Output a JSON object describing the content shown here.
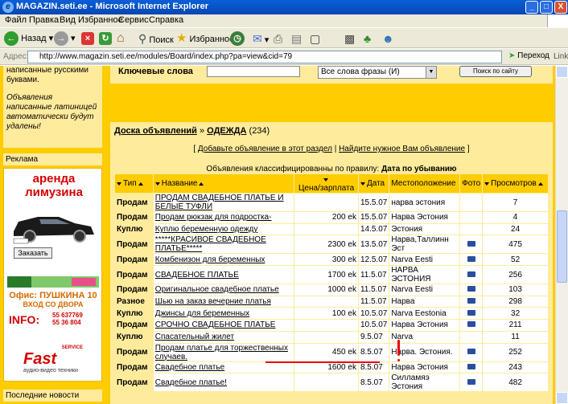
{
  "window": {
    "title": "MAGAZIN.seti.ee - Microsoft Internet Explorer",
    "minimize": "_",
    "maximize": "□",
    "close": "X"
  },
  "menu": [
    "Файл",
    "Правка",
    "Вид",
    "Избранное",
    "Сервис",
    "Справка"
  ],
  "toolbar": {
    "back": "Назад",
    "search": "Поиск",
    "favorites": "Избранное"
  },
  "address": {
    "label": "Адрес:",
    "url": "http://www.magazin.seti.ee/modules/Board/index.php?pa=view&cid=79",
    "go": "Переход",
    "links": "Links"
  },
  "sidebar": {
    "note1": "написанные русскими буквами.",
    "note2": "Объявления написанные латиницей автоматически будут удалены!",
    "ads_title": "Реклама",
    "limo_line1": "аренда",
    "limo_line2": "лимузина",
    "limo_order": "Заказать",
    "office": "Офис: ПУШКИНА 10",
    "office_enter": "ВХОД СО ДВОРА",
    "info": "INFO:",
    "phone1": "55 637769",
    "phone2": "55 36 804",
    "fast": "Fast",
    "fast_service": "SERVICE",
    "fast_sub": "аудио-видео техники",
    "news_title": "Последние новости"
  },
  "search": {
    "keywords_label": "Ключевые слова",
    "mode_selected": "Все слова фразы (И)",
    "button": "Поиск по сайту"
  },
  "board": {
    "crumb_root": "Доска объявлений",
    "crumb_sep": "»",
    "category": "ОДЕЖДА",
    "count": "(234)",
    "add_link": "Добавьте объявление в этот раздел",
    "find_link": "Найдите нужное Вам объявление",
    "sort_prefix": "Объявления классифицированны по правилу:",
    "sort_rule": "Дата по убыванию"
  },
  "table": {
    "headers": {
      "type": "Тип",
      "title": "Название",
      "price": "Цена/зарплата",
      "date": "Дата",
      "location": "Местоположение",
      "photo": "Фото",
      "views": "Просмотров"
    },
    "rows": [
      {
        "type": "Продам",
        "title": "ПРОДАМ СВАДЕБНОЕ ПЛАТЬЕ И БЕЛЫЕ ТУФЛИ",
        "price": "",
        "date": "15.5.07",
        "location": "нарва эстония",
        "photo": false,
        "views": "7"
      },
      {
        "type": "Продам",
        "title": "Продам рюкзак для подростка-",
        "price": "200 ek",
        "date": "15.5.07",
        "location": "Нарва Эстония",
        "photo": false,
        "views": "4"
      },
      {
        "type": "Куплю",
        "title": "Куплю беременную одежду",
        "price": "",
        "date": "14.5.07",
        "location": "Эстония",
        "photo": false,
        "views": "24"
      },
      {
        "type": "Продам",
        "title": "*****КРАСИВОЕ СВАДЕБНОЕ ПЛАТЬЕ*****",
        "price": "2300 ek",
        "date": "13.5.07",
        "location": "Нарва,Таллинн Эст",
        "photo": true,
        "views": "475"
      },
      {
        "type": "Продам",
        "title": "Комбенизон для беременных",
        "price": "300 ek",
        "date": "12.5.07",
        "location": "Narva Eesti",
        "photo": true,
        "views": "52"
      },
      {
        "type": "Продам",
        "title": "СВАДЕБНОЕ ПЛАТЬЕ",
        "price": "1700 ek",
        "date": "11.5.07",
        "location": "НАРВА ЭСТОНИЯ",
        "photo": true,
        "views": "256"
      },
      {
        "type": "Продам",
        "title": "Оригинальное свадебное платье",
        "price": "1000 ek",
        "date": "11.5.07",
        "location": "Narva Eesti",
        "photo": true,
        "views": "103"
      },
      {
        "type": "Разное",
        "title": "Шью на заказ вечерние платья",
        "price": "",
        "date": "11.5.07",
        "location": "Нарва",
        "photo": true,
        "views": "298"
      },
      {
        "type": "Куплю",
        "title": "Джинсы для беременных",
        "price": "100 ek",
        "date": "10.5.07",
        "location": "Narva Eestonia",
        "photo": true,
        "views": "32"
      },
      {
        "type": "Продам",
        "title": "СРОЧНО СВАДЕБНОЕ ПЛАТЬЕ",
        "price": "",
        "date": "10.5.07",
        "location": "Нарва Эстония",
        "photo": true,
        "views": "211"
      },
      {
        "type": "Куплю",
        "title": "Спасательный жилет",
        "price": "",
        "date": "9.5.07",
        "location": "Narva",
        "photo": false,
        "views": "11"
      },
      {
        "type": "Продам",
        "title": "Продам платье для торжественных случаев.",
        "price": "450 ek",
        "date": "8.5.07",
        "location": "Нарва. Эстония.",
        "photo": true,
        "views": "252"
      },
      {
        "type": "Продам",
        "title": "Свадебное платье",
        "price": "1600 ek",
        "date": "8.5.07",
        "location": "Нарва Эстония",
        "photo": true,
        "views": "243"
      },
      {
        "type": "Продам",
        "title": "Свадебное платье!",
        "price": "",
        "date": "8.5.07",
        "location": "Силламяэ Эстония",
        "photo": true,
        "views": "482"
      }
    ]
  }
}
